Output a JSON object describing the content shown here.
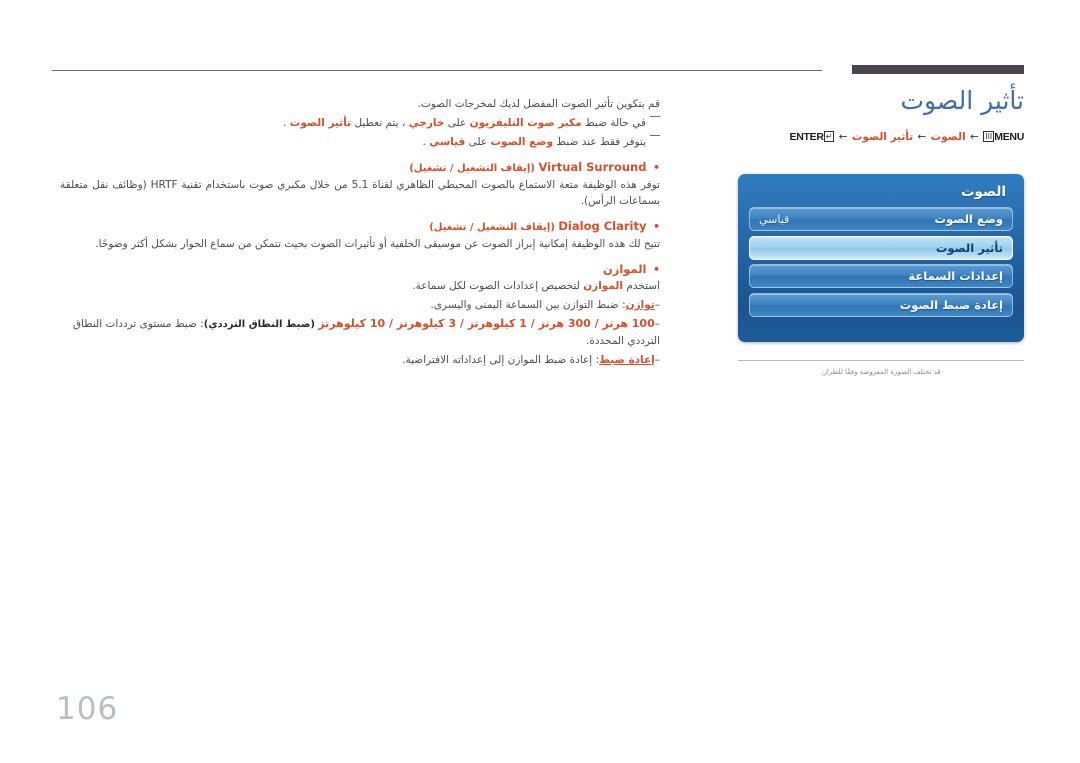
{
  "page": {
    "number": "106"
  },
  "header": {
    "title": "تأثير الصوت",
    "breadcrumb": {
      "menu_key": "MENU",
      "menu_icon": "menu-icon",
      "crumb1": "الصوت",
      "crumb2": "تأثير الصوت",
      "enter_key": "ENTER",
      "enter_icon": "enter-arrow-icon",
      "arrow": "←"
    }
  },
  "osd": {
    "title": "الصوت",
    "rows": [
      {
        "label": "وضع الصوت",
        "value": "قياسي",
        "selected": false
      },
      {
        "label": "تأثير الصوت",
        "value": "",
        "selected": true
      },
      {
        "label": "إعدادات السماعة",
        "value": "",
        "selected": false
      },
      {
        "label": "إعادة ضبط الصوت",
        "value": "",
        "selected": false
      }
    ]
  },
  "caption": {
    "text": "قد تختلف الصورة المعروضة وفقًا للطراز."
  },
  "body": {
    "intro": "قم بتكوين تأثير الصوت المفضل لديك لمخرجات الصوت.",
    "notes": [
      {
        "prefix": "في حالة ضبط",
        "bold1": "مكبر صوت التليفزيون",
        "mid1": "على",
        "bold2": "خارجي",
        "mid2": "، يتم تعطيل",
        "bold3": "تأثير الصوت",
        "suffix": "."
      },
      {
        "prefix": "يتوفر فقط عند ضبط",
        "bold1": "وضع الصوت",
        "mid1": "على",
        "bold2": "قياسي",
        "suffix": "."
      }
    ],
    "bullets": [
      {
        "term": "Virtual Surround",
        "options": "(إيقاف التشغيل / تشغيل)",
        "description": "توفر هذه الوظيفة متعة الاستماع بالصوت المحيطي الظاهري لقناة 5.1 من خلال مكبري صوت باستخدام تقنية HRTF (وظائف نقل متعلقة بسماعات الرأس).",
        "sublines": []
      },
      {
        "term": "Dialog Clarity",
        "options": "(إيقاف التشغيل / تشغيل)",
        "description": "تتيح لك هذه الوظيفة إمكانية إبراز الصوت عن موسيقى الخلفية أو تأثيرات الصوت بحيث تتمكن من سماع الحوار بشكل أكثر وضوحًا.",
        "sublines": []
      },
      {
        "term": "الموازن",
        "options": "",
        "description_prefix": "استخدم",
        "description_term": "الموازن",
        "description_suffix": "لتخصيص إعدادات الصوت لكل سماعة.",
        "sublines": [
          {
            "label": "توازن",
            "text": ": ضبط التوازن بين السماعة اليمنى واليسرى."
          },
          {
            "freq": "100 هرتز / 300 هرتز / 1 كيلوهرتز / 3 كيلوهرتز / 10 كيلوهرتز",
            "paren": "(ضبط النطاق الترددي)",
            "text": ": ضبط مستوى ترددات النطاق الترددي المحددة."
          },
          {
            "label": "إعادة ضبط",
            "text": ": إعادة ضبط الموازن إلى إعداداته الافتراضية."
          }
        ]
      }
    ]
  }
}
